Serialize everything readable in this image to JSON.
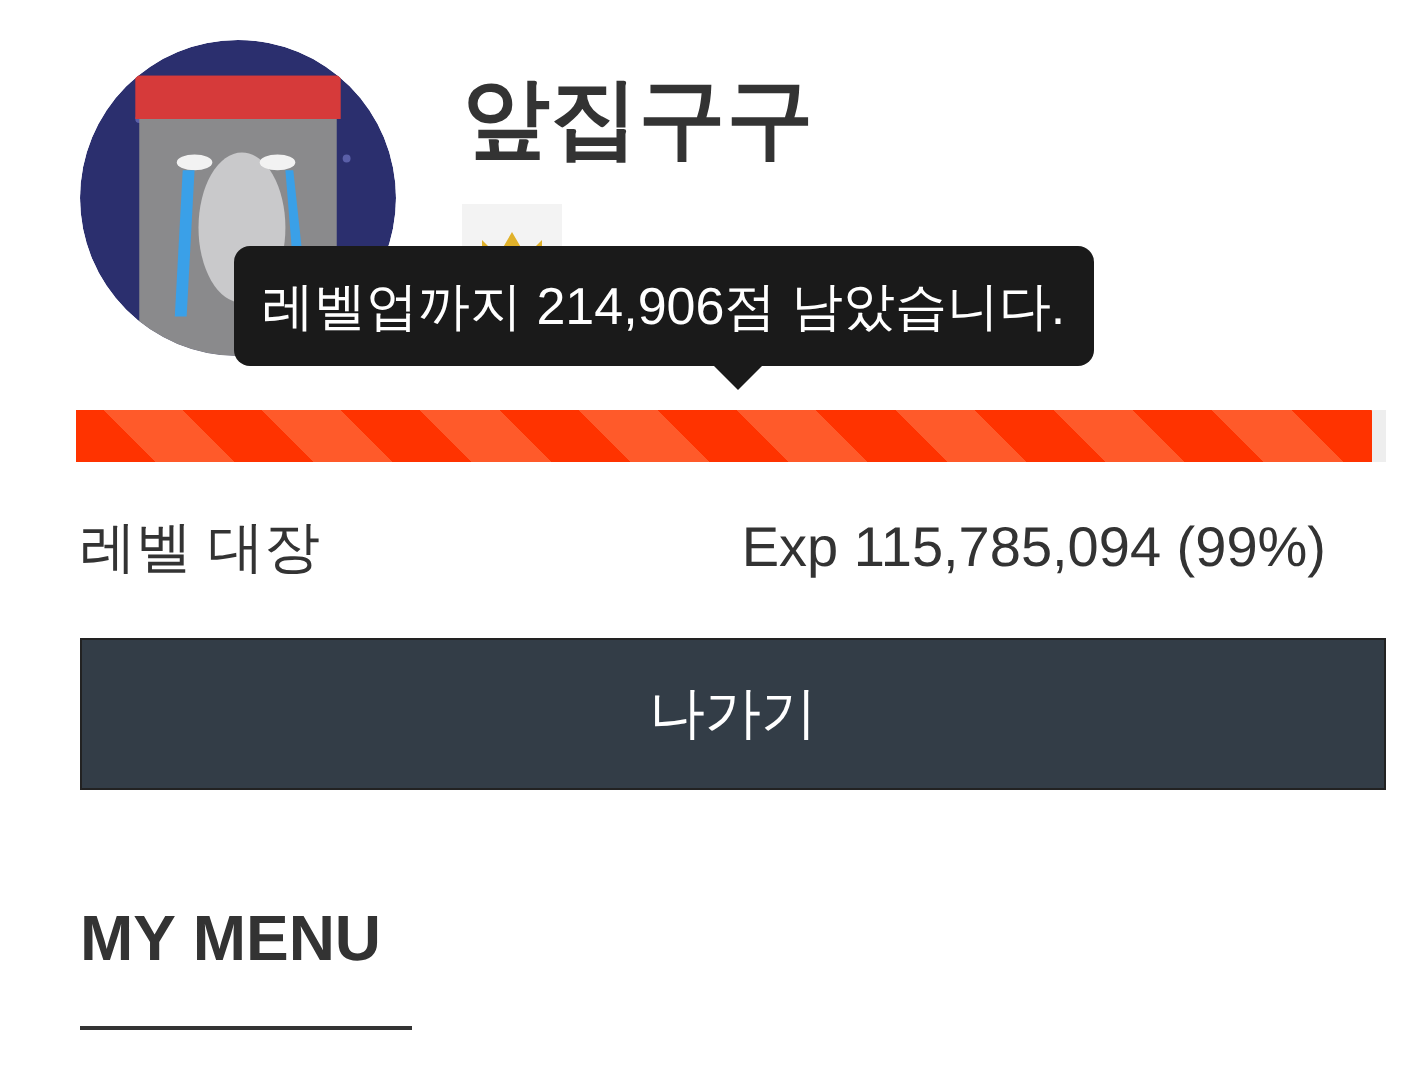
{
  "profile": {
    "name": "앞집구구"
  },
  "tooltip": "레벨업까지 214,906점 남았습니다.",
  "progress": {
    "level": 0.99
  },
  "level_label": "레벨 대장",
  "exp_reading": "Exp 115,785,094 (99%)",
  "logout_button": "나가기",
  "section_title": "MY MENU"
}
